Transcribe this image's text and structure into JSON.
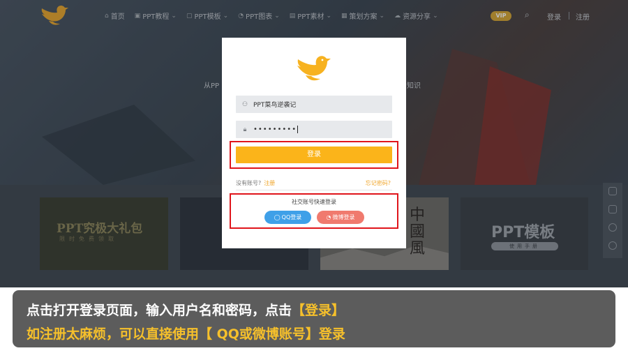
{
  "nav": {
    "items": [
      {
        "icon": "home-icon",
        "label": "首页"
      },
      {
        "icon": "ppt-icon",
        "label": "PPT教程"
      },
      {
        "icon": "template-icon",
        "label": "PPT模板"
      },
      {
        "icon": "chart-icon",
        "label": "PPT图表"
      },
      {
        "icon": "image-icon",
        "label": "PPT素材"
      },
      {
        "icon": "plan-icon",
        "label": "策划方案"
      },
      {
        "icon": "cloud-icon",
        "label": "资源分享"
      }
    ],
    "vip": "VIP",
    "login": "登录",
    "register": "注册"
  },
  "hero": {
    "text_left": "从PP",
    "text_right": "知识"
  },
  "cards": {
    "card1_title": "PPT究极大礼包",
    "card1_sub": "限时免费领取",
    "card3_title": "中國風",
    "card4_title": "PPT模板",
    "card4_sub": "使用手册"
  },
  "login_form": {
    "username": "PPT菜鸟逆袭记",
    "password": "•••••••••",
    "login_button": "登录",
    "no_account": "没有账号?",
    "register_link": "注册",
    "forgot_password": "忘记密码?",
    "social_title": "社交账号快速登录",
    "qq_button": "QQ登录",
    "weibo_button": "微博登录"
  },
  "caption": {
    "line1_prefix": "点击打开登录页面，输入用户名和密码，点击",
    "line1_highlight": "【登录】",
    "line2": "如注册太麻烦，可以直接使用【 QQ或微博账号】登录"
  },
  "colors": {
    "accent": "#fbb41a",
    "qq": "#3fa0e8",
    "weibo": "#f07a6e",
    "highlight_box": "#e0151b",
    "caption_bg": "#5c5c5c",
    "caption_highlight": "#f6c02b"
  }
}
